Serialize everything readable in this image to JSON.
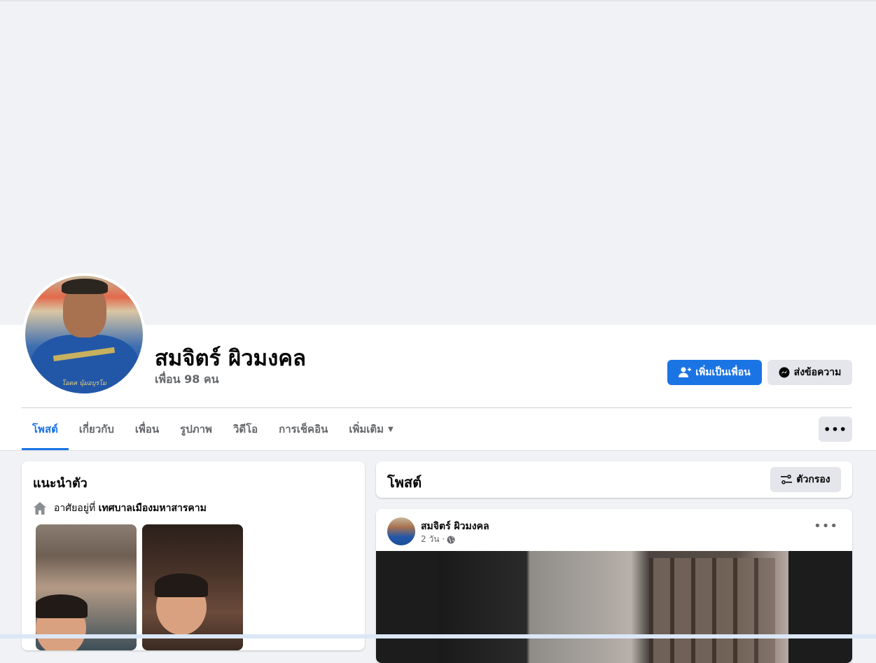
{
  "profile": {
    "name": "สมจิตร์ ผิวมงคล",
    "friends": "เพื่อน 98 คน",
    "avatar_caption": "โอดค นุ้มอบุรโม"
  },
  "actions": {
    "add_friend": "เพิ่มเป็นเพื่อน",
    "message": "ส่งข้อความ",
    "more": "•••"
  },
  "tabs": [
    {
      "label": "โพสต์",
      "active": true
    },
    {
      "label": "เกี่ยวกับ"
    },
    {
      "label": "เพื่อน"
    },
    {
      "label": "รูปภาพ"
    },
    {
      "label": "วิดีโอ"
    },
    {
      "label": "การเช็คอิน"
    },
    {
      "label": "เพิ่มเติม"
    }
  ],
  "intro": {
    "title": "แนะนำตัว",
    "lives_prefix": "อาศัยอยู่ที่",
    "lives_place": "เทศบาลเมืองมหาสารคาม"
  },
  "posts": {
    "title": "โพสต์",
    "filter_label": "ตัวกรอง",
    "items": [
      {
        "author": "สมจิตร์ ผิวมงคล",
        "time": "2 วัน ·",
        "menu": "•••"
      }
    ]
  },
  "colors": {
    "accent": "#1b74e4",
    "background": "#f0f2f5",
    "secondary_text": "#65676b",
    "button_gray": "#e4e6eb"
  }
}
